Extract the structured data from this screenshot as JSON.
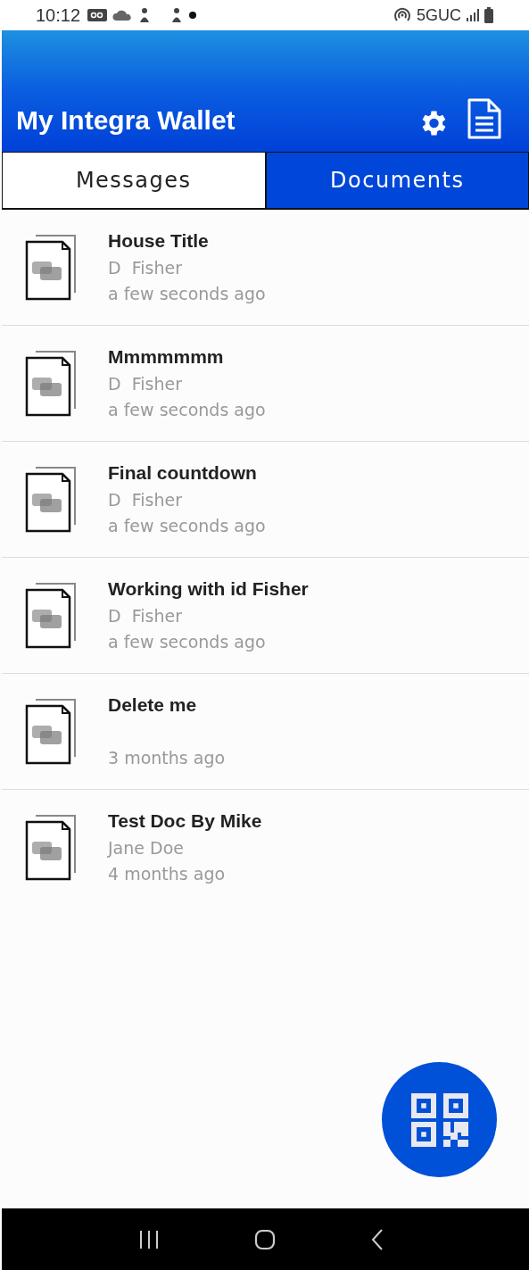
{
  "status_bar": {
    "time": "10:12",
    "network": "5GUC"
  },
  "header": {
    "title": "My Integra Wallet"
  },
  "tabs": [
    {
      "label": "Messages",
      "selected": false
    },
    {
      "label": "Documents",
      "selected": true
    }
  ],
  "documents": [
    {
      "title": "House Title",
      "author": "D  Fisher",
      "time": "a few seconds ago"
    },
    {
      "title": "Mmmmmmm",
      "author": "D  Fisher",
      "time": "a few seconds ago"
    },
    {
      "title": "Final countdown",
      "author": "D  Fisher",
      "time": "a few seconds ago"
    },
    {
      "title": "Working with id Fisher",
      "author": "D  Fisher",
      "time": "a few seconds ago"
    },
    {
      "title": "Delete me",
      "time": "3 months ago"
    },
    {
      "title": "Test Doc By Mike",
      "author": "Jane Doe",
      "time": "4 months ago"
    }
  ]
}
